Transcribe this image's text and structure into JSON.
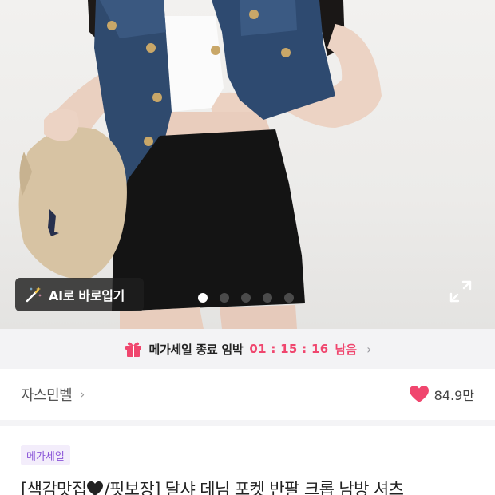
{
  "product_image": {
    "ai_try_on_label": "AI로 바로입기",
    "slide_count": 5,
    "active_slide": 1
  },
  "sale_banner": {
    "text": "메가세일 종료 임박",
    "timer": "01 : 15 : 16",
    "remaining_label": "남음",
    "accent_color": "#f0466e"
  },
  "shop": {
    "name": "자스민벨",
    "like_count": "84.9만",
    "heart_color": "#f0466e"
  },
  "product": {
    "badge": "메가세일",
    "title_prefix": "[색감맛집",
    "title_suffix": "/핏보장] 달샤 데님 포켓 반팔 크롭 남방 셔츠"
  }
}
